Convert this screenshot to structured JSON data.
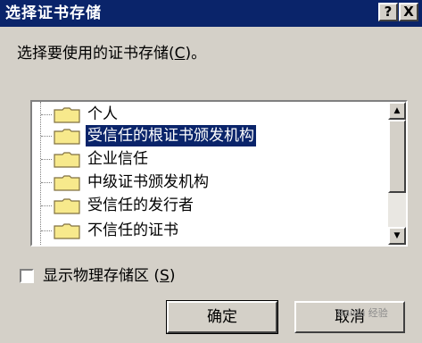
{
  "window": {
    "title": "选择证书存储",
    "help_button": "?",
    "close_button": "X"
  },
  "prompt": {
    "before": "选择要使用的证书存储(",
    "mnemonic": "C",
    "after": ")。"
  },
  "stores": [
    {
      "label": "个人",
      "selected": false
    },
    {
      "label": "受信任的根证书颁发机构",
      "selected": true
    },
    {
      "label": "企业信任",
      "selected": false
    },
    {
      "label": "中级证书颁发机构",
      "selected": false
    },
    {
      "label": "受信任的发行者",
      "selected": false
    },
    {
      "label": "不信任的证书",
      "selected": false
    }
  ],
  "show_physical": {
    "before": "显示物理存储区 (",
    "mnemonic": "S",
    "after": ")",
    "checked": false
  },
  "buttons": {
    "ok": "确定",
    "cancel": "取消"
  },
  "watermark": "Baidu 经验",
  "colors": {
    "titlebar": "#0a246a",
    "dialog": "#d4d0c8",
    "selection": "#0a246a",
    "folder": "#f7e98c"
  }
}
